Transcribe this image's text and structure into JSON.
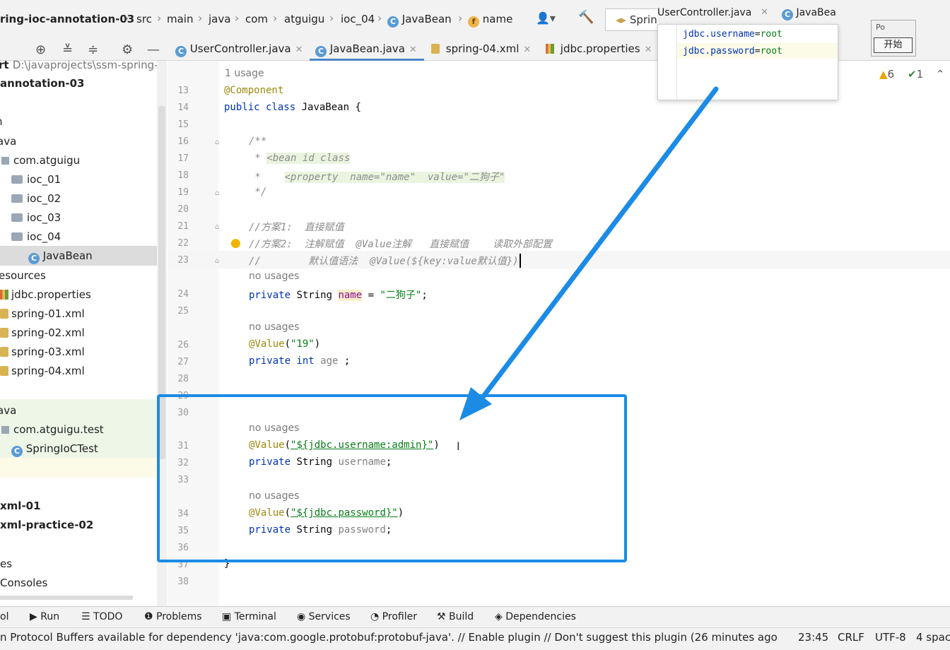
{
  "navbar": {
    "project": "ring-ioc-annotation-03",
    "crumbs": [
      "src",
      "main",
      "java",
      "com",
      "atguigu",
      "ioc_04",
      "JavaBean",
      "name"
    ],
    "run_config": "Sprin"
  },
  "tabs": [
    {
      "label": "UserController.java"
    },
    {
      "label": "JavaBean.java"
    },
    {
      "label": "spring-04.xml"
    },
    {
      "label": "jdbc.properties"
    }
  ],
  "project_tree": {
    "root_label": "rt",
    "root_path": "D:\\javaprojects\\ssm-spring-pa",
    "items": [
      {
        "label": "annotation-03"
      },
      {
        "label": "n"
      },
      {
        "label": "ava"
      },
      {
        "label": "com.atguigu"
      },
      {
        "label": "ioc_01"
      },
      {
        "label": "ioc_02"
      },
      {
        "label": "ioc_03"
      },
      {
        "label": "ioc_04"
      },
      {
        "label": "JavaBean"
      },
      {
        "label": "esources"
      },
      {
        "label": "jdbc.properties"
      },
      {
        "label": "spring-01.xml"
      },
      {
        "label": "spring-02.xml"
      },
      {
        "label": "spring-03.xml"
      },
      {
        "label": "spring-04.xml"
      },
      {
        "label": "ava"
      },
      {
        "label": "com.atguigu.test"
      },
      {
        "label": "SpringIoCTest"
      },
      {
        "label": "xml-01"
      },
      {
        "label": "xml-practice-02"
      },
      {
        "label": "es"
      },
      {
        "label": "Consoles"
      }
    ]
  },
  "editor": {
    "usage_hint": "1 usage",
    "no_usages": "no usages",
    "line_numbers": [
      "13",
      "14",
      "15",
      "16",
      "17",
      "18",
      "19",
      "20",
      "21",
      "22",
      "23",
      "24",
      "25",
      "26",
      "27",
      "28",
      "29",
      "30",
      "31",
      "32",
      "33",
      "34",
      "35",
      "36",
      "37",
      "38"
    ],
    "code": {
      "l13": "@Component",
      "l14_kw": "public class",
      "l14_rest": " JavaBean {",
      "l16": "/**",
      "l17_star": " * ",
      "l17_tag": "<bean id class",
      "l18_star": " *    ",
      "l18_tag": "<property  name=\"name\"  value=\"二狗子\"",
      "l19": " */",
      "l21": "//方案1:  直接赋值",
      "l22": "//方案2:  注解赋值  @Value注解   直接赋值    读取外部配置",
      "l23": "//        默认值语法  @Value(${key:value默认值})",
      "l24_kw": "private",
      "l24_type": " String ",
      "l24_field": "name",
      "l24_eq": " = ",
      "l24_str": "\"二狗子\"",
      "l24_end": ";",
      "l26_ann": "@Value",
      "l26_open": "(",
      "l26_str": "\"19\"",
      "l26_close": ")",
      "l27_kw": "private int",
      "l27_field": " age",
      "l27_end": " ;",
      "l31_ann": "@Value",
      "l31_open": "(",
      "l31_str": "\"${jdbc.username:admin}\"",
      "l31_close": ")",
      "l32_kw": "private",
      "l32_type": " String ",
      "l32_field": "username",
      "l32_end": ";",
      "l34_ann": "@Value",
      "l34_open": "(",
      "l34_str": "\"${jdbc.password}\"",
      "l34_close": ")",
      "l35_kw": "private",
      "l35_type": " String ",
      "l35_field": "password",
      "l35_end": ";",
      "l37": "}"
    },
    "warnings": "6",
    "checks": "1"
  },
  "popup": {
    "tab1": "UserController.java",
    "tab2": "JavaBea",
    "line1_key": "jdbc.username",
    "line1_eq": "=",
    "line1_val": "root",
    "line2_key": "jdbc.password",
    "line2_eq": "=",
    "line2_val": "root"
  },
  "dialog": {
    "label": "Po",
    "button": "开始"
  },
  "toolwindows": [
    "ol",
    "Run",
    "TODO",
    "Problems",
    "Terminal",
    "Services",
    "Profiler",
    "Build",
    "Dependencies"
  ],
  "status": {
    "message": "n Protocol Buffers available for dependency 'java:com.google.protobuf:protobuf-java'. // Enable plugin // Don't suggest this plugin (26 minutes ago)",
    "position": "23:45",
    "line_sep": "CRLF",
    "encoding": "UTF-8",
    "indent": "4 spac"
  },
  "colors": {
    "accent": "#1b8be6",
    "keyword": "#0033b3",
    "string": "#067d17",
    "annotation": "#9e880d"
  }
}
